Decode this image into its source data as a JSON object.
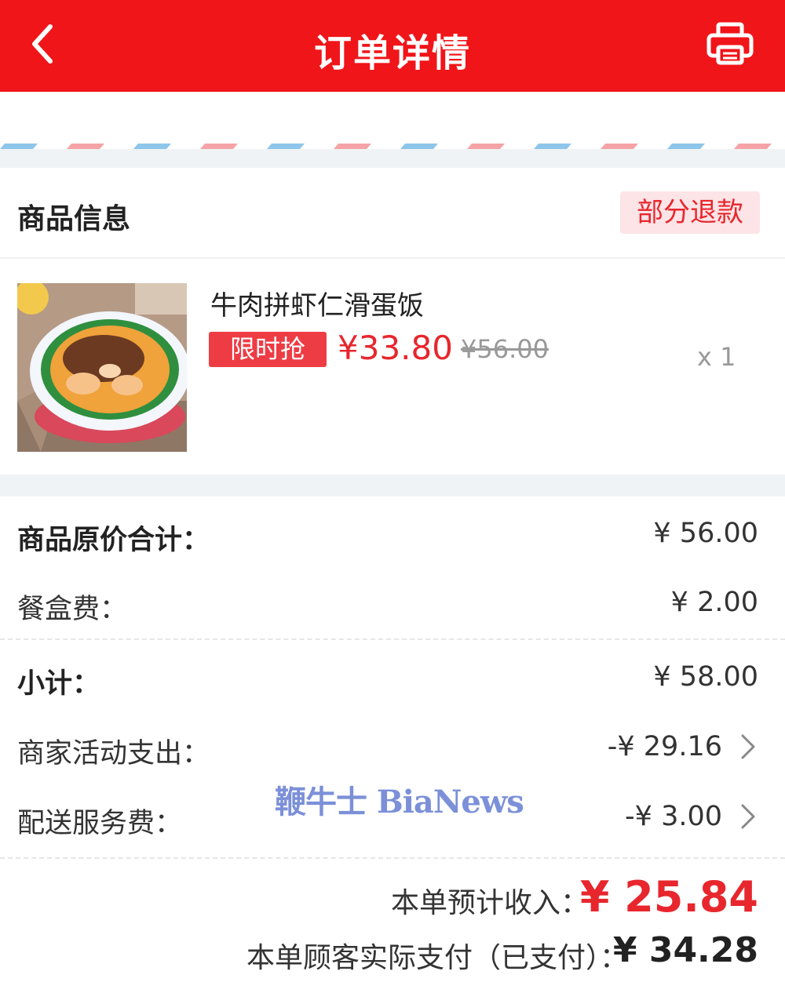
{
  "header": {
    "title": "订单详情",
    "back_icon": "chevron-left-icon",
    "print_icon": "printer-icon",
    "background_color": "#f01519"
  },
  "product_section": {
    "title": "商品信息",
    "status_badge": "部分退款",
    "item": {
      "name": "牛肉拼虾仁滑蛋饭",
      "tag": "限时抢",
      "price": "¥33.80",
      "original_price": "¥56.00",
      "quantity": "x 1"
    }
  },
  "fees": {
    "original_total": {
      "label": "商品原价合计：",
      "value": "¥ 56.00"
    },
    "box_fee": {
      "label": "餐盒费：",
      "value": "¥ 2.00"
    },
    "subtotal": {
      "label": "小计：",
      "value": "¥ 58.00"
    },
    "merchant_activity": {
      "label": "商家活动支出：",
      "value": "-¥ 29.16"
    },
    "delivery_fee": {
      "label": "配送服务费：",
      "value": "-¥ 3.00"
    }
  },
  "summary": {
    "income_label": "本单预计收入：",
    "income_value": "¥ 25.84",
    "paid_label": "本单顾客实际支付（已支付）：",
    "paid_value": "¥ 34.28"
  },
  "watermark": "鞭牛士 BiaNews",
  "colors": {
    "accent_red": "#e8262d",
    "badge_bg": "#fde4e6",
    "gray_bar": "#eff3f5"
  }
}
